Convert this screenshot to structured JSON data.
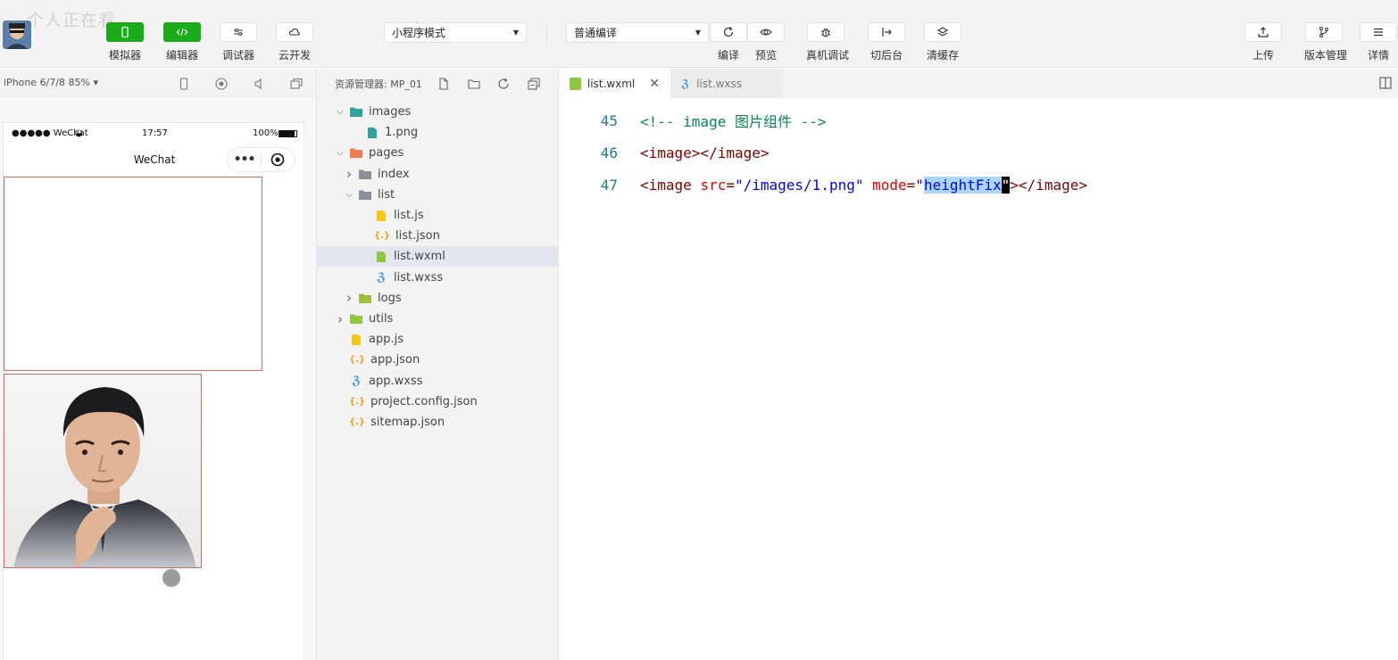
{
  "watermark": "个人正在看",
  "toolbar": {
    "simulator": "模拟器",
    "editor": "编辑器",
    "debugger": "调试器",
    "cloud": "云开发",
    "mode_select": "小程序模式",
    "compile_select": "普通编译",
    "compile": "编译",
    "preview": "预览",
    "real_debug": "真机调试",
    "background": "切后台",
    "clear_cache": "清缓存",
    "upload": "上传",
    "version": "版本管理",
    "details": "详情"
  },
  "simulator": {
    "device": "iPhone 6/7/8 85%",
    "status_left": "●●●●● WeChat",
    "status_time": "17:57",
    "status_battery": "100%",
    "nav_title": "WeChat"
  },
  "explorer": {
    "title": "资源管理器: MP_01",
    "tree": [
      {
        "label": "images",
        "icon": "folder-images-icon",
        "expanded": true
      },
      {
        "label": "1.png",
        "icon": "image-file-icon"
      },
      {
        "label": "pages",
        "icon": "folder-pages-icon",
        "expanded": true
      },
      {
        "label": "index",
        "icon": "folder-icon",
        "expanded": false
      },
      {
        "label": "list",
        "icon": "folder-icon",
        "expanded": true
      },
      {
        "label": "list.js",
        "icon": "js-file-icon"
      },
      {
        "label": "list.json",
        "icon": "json-file-icon"
      },
      {
        "label": "list.wxml",
        "icon": "wxml-file-icon",
        "selected": true
      },
      {
        "label": "list.wxss",
        "icon": "wxss-file-icon"
      },
      {
        "label": "logs",
        "icon": "folder-icon",
        "expanded": false
      },
      {
        "label": "utils",
        "icon": "folder-icon",
        "expanded": false
      },
      {
        "label": "app.js",
        "icon": "js-file-icon"
      },
      {
        "label": "app.json",
        "icon": "json-file-icon"
      },
      {
        "label": "app.wxss",
        "icon": "wxss-file-icon"
      },
      {
        "label": "project.config.json",
        "icon": "json-file-icon"
      },
      {
        "label": "sitemap.json",
        "icon": "json-file-icon"
      }
    ]
  },
  "editor": {
    "tabs": [
      {
        "label": "list.wxml",
        "active": true
      },
      {
        "label": "list.wxss",
        "active": false
      }
    ],
    "lines": [
      {
        "num": "45",
        "comment": "<!-- image 图片组件 -->"
      },
      {
        "num": "46",
        "tag": "<image></image>"
      },
      {
        "num": "47",
        "open": "<image ",
        "attr1": "src",
        "eq1": "=",
        "val1": "\"/images/1.png\"",
        "space": " ",
        "attr2": "mode",
        "eq2": "=",
        "quote_open": "\"",
        "selected": "heightFix",
        "quote_close": "\"",
        "close": "></image>"
      }
    ]
  },
  "colors": {
    "accent_green": "#1aad19",
    "code_comment": "#098658",
    "code_tag": "#800000",
    "code_attr": "#e50000",
    "code_string": "#0000ff"
  }
}
